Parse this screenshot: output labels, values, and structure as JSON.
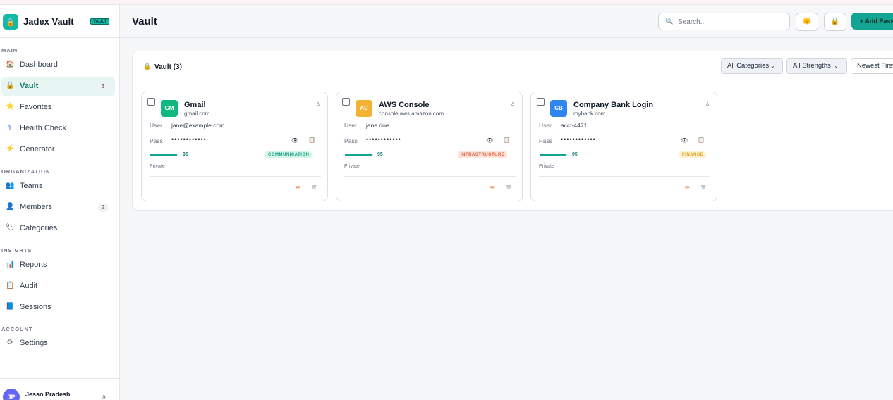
{
  "colors": {
    "accent": "#12a594",
    "accent_light": "#e8f6f3"
  },
  "brand": {
    "name": "Jadex Vault",
    "badge": "VAULT",
    "logo_icon": "lock-icon"
  },
  "sidebar": {
    "sections": [
      {
        "label": "MAIN",
        "items": [
          {
            "label": "Dashboard",
            "icon": "house-icon"
          },
          {
            "label": "Vault",
            "icon": "lock-icon",
            "count": "3",
            "active": true
          },
          {
            "label": "Favorites",
            "icon": "star-icon"
          },
          {
            "label": "Health Check",
            "icon": "stethoscope-icon"
          },
          {
            "label": "Generator",
            "icon": "lightning-icon"
          }
        ]
      },
      {
        "label": "ORGANIZATION",
        "items": [
          {
            "label": "Teams",
            "icon": "people-icon"
          },
          {
            "label": "Members",
            "icon": "person-icon",
            "count": "2"
          },
          {
            "label": "Categories",
            "icon": "tag-icon"
          }
        ]
      },
      {
        "label": "INSIGHTS",
        "items": [
          {
            "label": "Reports",
            "icon": "bar-chart-icon"
          },
          {
            "label": "Audit",
            "icon": "clipboard-icon"
          },
          {
            "label": "Sessions",
            "icon": "book-icon"
          }
        ]
      },
      {
        "label": "ACCOUNT",
        "items": [
          {
            "label": "Settings",
            "icon": "gear-icon"
          }
        ]
      }
    ],
    "user": {
      "initials": "JP",
      "name": "Jesso Pradesh"
    }
  },
  "header": {
    "title": "Vault",
    "search_placeholder": "Search...",
    "theme_icon": "sun-icon",
    "lock_icon": "lock-icon",
    "add_label": "+ Add Password"
  },
  "panel": {
    "title": "Vault (3)",
    "filters": [
      "All Categories",
      "All Strengths",
      "Newest First"
    ]
  },
  "entries": [
    {
      "initials": "GM",
      "name": "Gmail",
      "domain": "gmail.com",
      "user_label": "User",
      "user": "jane@example.com",
      "pass_label": "Pass",
      "pass_mask": "••••••••••••",
      "strength": 95,
      "category": "COMMUNICATION",
      "visibility": "Private",
      "logo_color": "#10b981",
      "cat_bg": "#d5f5ec",
      "cat_fg": "#0f9f7a"
    },
    {
      "initials": "AC",
      "name": "AWS Console",
      "domain": "console.aws.amazon.com",
      "user_label": "User",
      "user": "jane.doe",
      "pass_label": "Pass",
      "pass_mask": "••••••••••••",
      "strength": 95,
      "category": "INFRASTRUCTURE",
      "visibility": "Private",
      "logo_color": "#f5b335",
      "cat_bg": "#fde4dc",
      "cat_fg": "#e0582e"
    },
    {
      "initials": "CB",
      "name": "Company Bank Login",
      "domain": "mybank.com",
      "user_label": "User",
      "user": "acct-4471",
      "pass_label": "Pass",
      "pass_mask": "••••••••••••",
      "strength": 95,
      "category": "FINANCE",
      "visibility": "Private",
      "logo_color": "#2f86f0",
      "cat_bg": "#fdf3d4",
      "cat_fg": "#e0a11b"
    }
  ]
}
